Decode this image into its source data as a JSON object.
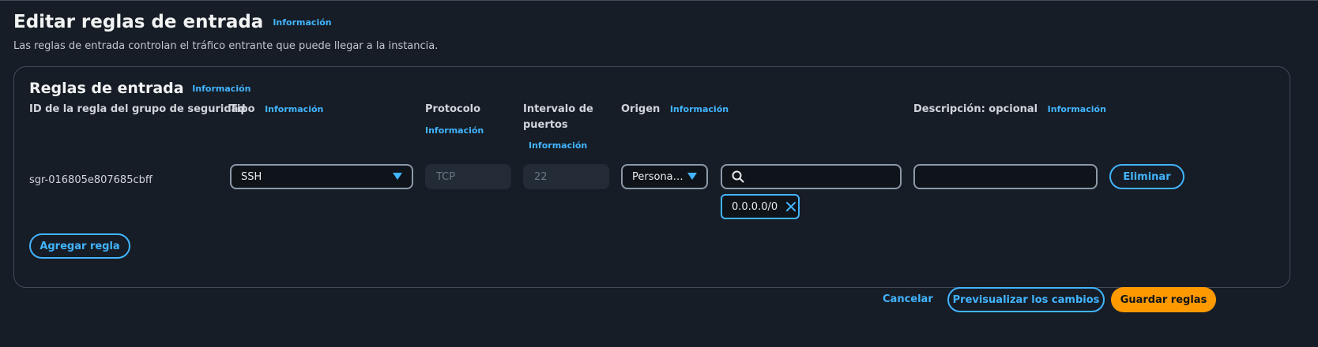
{
  "page": {
    "title": "Editar reglas de entrada",
    "title_info": "Información",
    "subtitle": "Las reglas de entrada controlan el tráfico entrante que puede llegar a la instancia."
  },
  "panel": {
    "title": "Reglas de entrada",
    "title_info": "Información",
    "columns": {
      "rule_id": "ID de la regla del grupo de seguridad",
      "type": "Tipo",
      "type_info": "Información",
      "protocol": "Protocolo",
      "protocol_info": "Información",
      "port_range_line1": "Intervalo de",
      "port_range_line2": "puertos",
      "port_range_info": "Información",
      "source": "Origen",
      "source_info": "Información",
      "description": "Descripción: opcional",
      "description_info": "Información"
    },
    "rules": [
      {
        "id": "sgr-016805e807685cbff",
        "type": "SSH",
        "protocol": "TCP",
        "port_range": "22",
        "source_type": "Persona…",
        "source_search_value": "",
        "source_token": "0.0.0.0/0",
        "description_value": "",
        "delete_label": "Eliminar"
      }
    ],
    "add_rule_label": "Agregar regla"
  },
  "footer": {
    "cancel_label": "Cancelar",
    "preview_label": "Previsualizar los cambios",
    "save_label": "Guardar reglas"
  },
  "colors": {
    "background": "#161d26",
    "accent": "#42b4ff",
    "primary": "#ff9900"
  },
  "icons": [
    "caret-down-icon",
    "search-icon",
    "close-icon"
  ]
}
